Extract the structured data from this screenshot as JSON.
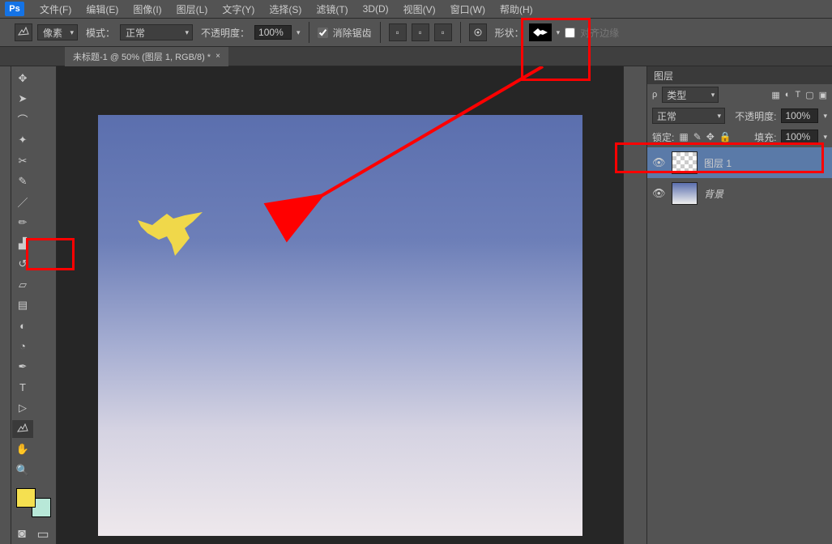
{
  "menubar": {
    "logo": "Ps",
    "items": [
      "文件(F)",
      "编辑(E)",
      "图像(I)",
      "图层(L)",
      "文字(Y)",
      "选择(S)",
      "滤镜(T)",
      "3D(D)",
      "视图(V)",
      "窗口(W)",
      "帮助(H)"
    ]
  },
  "optbar": {
    "unit": "像素",
    "mode_label": "模式：",
    "mode": "正常",
    "opacity_label": "不透明度：",
    "opacity": "100%",
    "antialias": "消除锯齿",
    "shape_label": "形状：",
    "align": "对齐边缘"
  },
  "tab": {
    "title": "未标题-1 @ 50% (图层 1, RGB/8) *",
    "close": "×"
  },
  "layers_panel": {
    "title": "图层",
    "kind_label": "类型",
    "blend": "正常",
    "opacity_label": "不透明度:",
    "opacity": "100%",
    "lock_label": "锁定:",
    "fill_label": "填充:",
    "fill": "100%",
    "layers": [
      {
        "name": "图层 1",
        "active": true,
        "checker": true
      },
      {
        "name": "背景",
        "active": false,
        "checker": false
      }
    ]
  },
  "colors": {
    "fg": "#f5e050",
    "bg": "#b8e8d8"
  }
}
